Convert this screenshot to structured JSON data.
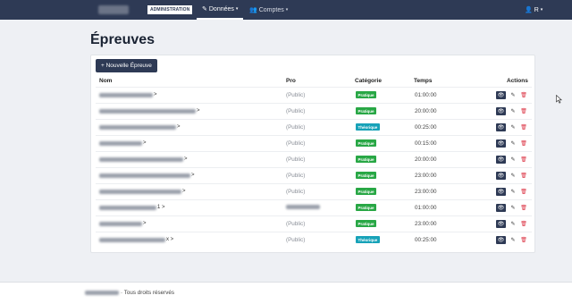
{
  "topbar": {
    "admin_badge": "ADMINISTRATION",
    "nav": [
      {
        "label": "Données",
        "icon": "edit-icon",
        "active": true
      },
      {
        "label": "Comptes",
        "icon": "users-icon",
        "active": false
      }
    ],
    "user_label": "R"
  },
  "page": {
    "title": "Épreuves",
    "new_button": "+ Nouvelle Épreuve"
  },
  "table": {
    "headers": {
      "nom": "Nom",
      "pro": "Pro",
      "categorie": "Catégorie",
      "temps": "Temps",
      "actions": "Actions"
    },
    "rows": [
      {
        "name": ">",
        "pro": "(Public)",
        "categorie": "Pratique",
        "temps": "01:00:00"
      },
      {
        "name": ">",
        "pro": "(Public)",
        "categorie": "Pratique",
        "temps": "20:00:00"
      },
      {
        "name": ">",
        "pro": "(Public)",
        "categorie": "Théorique",
        "temps": "00:25:00"
      },
      {
        "name": ">",
        "pro": "(Public)",
        "categorie": "Pratique",
        "temps": "00:15:00"
      },
      {
        "name": ">",
        "pro": "(Public)",
        "categorie": "Pratique",
        "temps": "20:00:00"
      },
      {
        "name": ">",
        "pro": "(Public)",
        "categorie": "Pratique",
        "temps": "23:00:00"
      },
      {
        "name": ">",
        "pro": "(Public)",
        "categorie": "Pratique",
        "temps": "23:00:00"
      },
      {
        "name": "1 >",
        "pro": "",
        "categorie": "Pratique",
        "temps": "01:00:00"
      },
      {
        "name": ">",
        "pro": "(Public)",
        "categorie": "Pratique",
        "temps": "23:00:00"
      },
      {
        "name": "x >",
        "pro": "(Public)",
        "categorie": "Théorique",
        "temps": "00:25:00"
      }
    ]
  },
  "footer": {
    "text": "· Tous droits réservés"
  },
  "colors": {
    "navbar": "#2e3a55",
    "pratique": "#28a745",
    "theorique": "#17a2b8",
    "danger": "#dc3545"
  }
}
